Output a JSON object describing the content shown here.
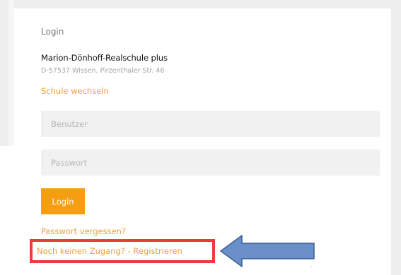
{
  "login_card": {
    "title": "Login",
    "school_name": "Marion-Dönhoff-Realschule plus",
    "school_address": "D-57537 Wissen, Pirzenthaler Str. 46",
    "change_school_link": "Schule wechseln",
    "username_placeholder": "Benutzer",
    "password_placeholder": "Passwort",
    "login_button": "Login",
    "forgot_password_link": "Passwort vergessen?",
    "register_link": "Noch keinen Zugang? - Registrieren"
  },
  "annotation": {
    "highlight_color": "#ee3b3b",
    "arrow_fill": "#6b8fc9",
    "arrow_stroke": "#3d5f96",
    "arrow_direction": "left"
  },
  "colors": {
    "accent": "#f59d13",
    "link": "#f2a03a",
    "field_background": "#f1f1f1"
  }
}
